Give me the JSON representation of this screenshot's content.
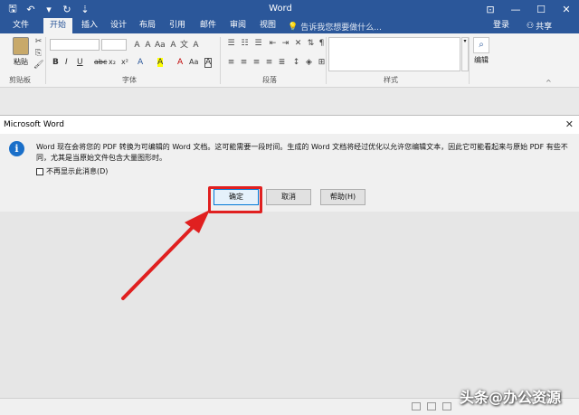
{
  "titlebar": {
    "title": "Word",
    "qat": [
      {
        "icon": "save-icon",
        "glyph": "🖫"
      },
      {
        "icon": "undo-icon",
        "glyph": "↶"
      },
      {
        "icon": "dropdown-icon",
        "glyph": "▾"
      },
      {
        "icon": "redo-icon",
        "glyph": "↻"
      },
      {
        "icon": "customize-icon",
        "glyph": "⇣"
      }
    ],
    "controls": [
      {
        "icon": "ribbon-options-icon",
        "glyph": "⊡"
      },
      {
        "icon": "minimize-icon",
        "glyph": "—"
      },
      {
        "icon": "maximize-icon",
        "glyph": "☐"
      },
      {
        "icon": "close-icon",
        "glyph": "✕"
      }
    ]
  },
  "tabs": {
    "items": [
      "文件",
      "开始",
      "插入",
      "设计",
      "布局",
      "引用",
      "邮件",
      "审阅",
      "视图"
    ],
    "active_index": 1,
    "tell_me": "告诉我您想要做什么...",
    "login": "登录",
    "share": "共享"
  },
  "ribbon": {
    "paste_label": "粘贴",
    "groups": {
      "clipboard": "剪贴板",
      "font": "字体",
      "paragraph": "段落",
      "styles": "样式",
      "editing": "编辑"
    },
    "format_buttons": [
      "B",
      "I",
      "U",
      "abc",
      "x₂",
      "x²",
      "A",
      "A",
      "A",
      "Aa",
      "A"
    ]
  },
  "dialog": {
    "title": "Microsoft Word",
    "close_glyph": "✕",
    "info_glyph": "i",
    "message": "Word 现在会将您的 PDF 转换为可编辑的 Word 文档。这可能需要一段时间。生成的 Word 文档将经过优化以允许您编辑文本，因此它可能看起来与原始 PDF 有些不同，尤其是当原始文件包含大量图形时。",
    "checkbox_label": "不再显示此消息(D)",
    "buttons": {
      "ok": "确定",
      "cancel": "取消",
      "help": "帮助(H)"
    }
  },
  "watermark": "头条@办公资源",
  "colors": {
    "word_blue": "#2b579a",
    "highlight_red": "#e02020"
  }
}
